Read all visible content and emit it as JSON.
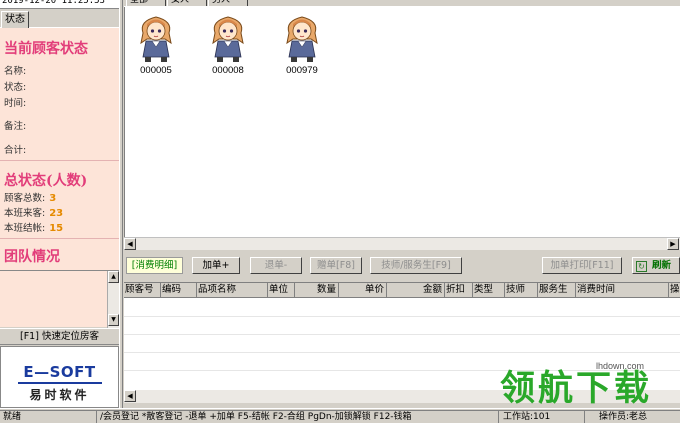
{
  "clock": "2019-12-20  11:25:53",
  "left_tab": "状态",
  "current": {
    "title": "当前顾客状态",
    "fields": [
      "名称:",
      "状态:",
      "时间:",
      "备注:",
      "合计:"
    ]
  },
  "totals": {
    "title": "总状态(人数)",
    "rows": [
      {
        "label": "顾客总数:",
        "value": "3"
      },
      {
        "label": "本班来客:",
        "value": "23"
      },
      {
        "label": "本班结帐:",
        "value": "15"
      }
    ]
  },
  "team": {
    "title": "团队情况"
  },
  "quick_find": "[F1] 快速定位房客",
  "logo": {
    "main": "E—SOFT",
    "sub": "易时软件"
  },
  "top_tabs": [
    "全部",
    "女人",
    "男人"
  ],
  "rooms": [
    {
      "number": "000005"
    },
    {
      "number": "000008"
    },
    {
      "number": "000979"
    }
  ],
  "toolbar": {
    "detail_label": "[消费明细]",
    "add": "加单+",
    "remove": "退单-",
    "gift": "赠单[F8]",
    "tech": "技师/服务生[F9]",
    "print": "加单打印[F11]",
    "refresh": "刷新"
  },
  "grid": {
    "columns": [
      "顾客号",
      "编码",
      "品项名称",
      "单位",
      "数量",
      "单价",
      "金额",
      "折扣",
      "类型",
      "技师",
      "服务生",
      "消费时间",
      "操"
    ]
  },
  "statusbar": {
    "ready": "就绪",
    "shortcuts": "/会员登记 *散客登记 -退单 +加单 F5-结帐 F2-合组 PgDn-加锁解锁 F12-钱箱",
    "workstation": "工作站:101",
    "operator": "操作员:老总"
  },
  "watermark": {
    "url": "lhdown.com",
    "text": "领航下载"
  },
  "colors": {
    "accent_pink": "#e23d7a",
    "count_orange": "#e58a00",
    "panel_bg": "#fde4d8",
    "logo_blue": "#1a3b9e",
    "watermark_green": "#2aa82a"
  }
}
